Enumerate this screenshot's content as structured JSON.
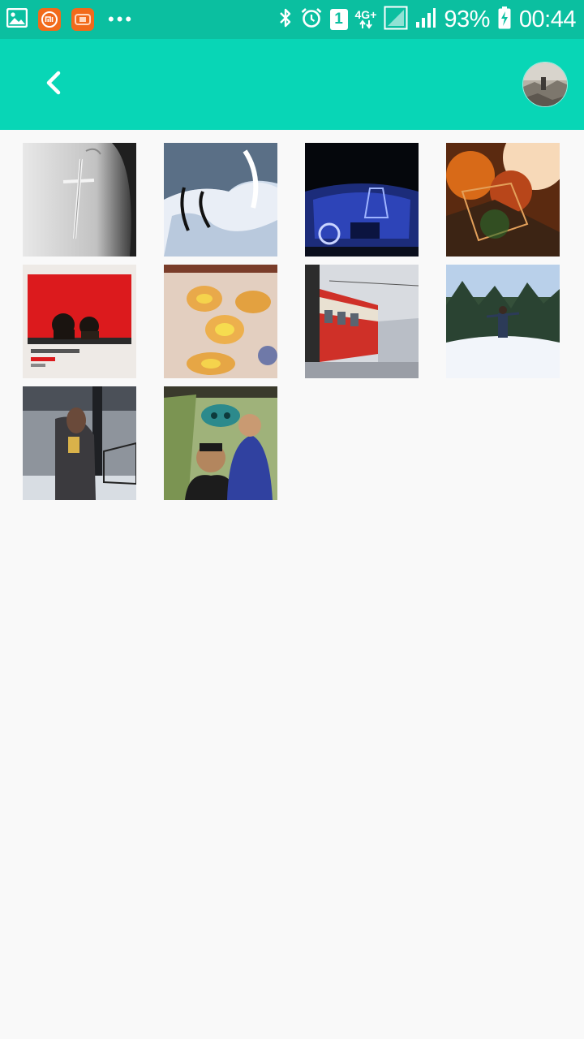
{
  "status_bar": {
    "battery": "93%",
    "time": "00:44",
    "sim_slot": "1",
    "network_type": "4G+",
    "icons": [
      "gallery-icon",
      "mi-app-icon",
      "orange-app-icon",
      "more-notifications-icon",
      "bluetooth-icon",
      "alarm-icon",
      "sim-1-icon",
      "network-4g-icon",
      "signal-icon",
      "battery-charging-icon"
    ]
  },
  "app_bar": {
    "back_icon": "chevron-left-icon",
    "colors": {
      "status_bar": "#0bbfa0",
      "app_bar": "#08d6b6",
      "background": "#f9f9f9"
    }
  },
  "photos": [
    {
      "id": "photo-earring",
      "subject": "cross earring close-up, black and white"
    },
    {
      "id": "photo-snow-ice",
      "subject": "ice and snow with black marks"
    },
    {
      "id": "photo-car-dashboard",
      "subject": "car dashboard at night, blue tint"
    },
    {
      "id": "photo-autumn-leaves",
      "subject": "sunlit autumn leaves"
    },
    {
      "id": "photo-youtube-frame",
      "subject": "two people in a YouTube frame"
    },
    {
      "id": "photo-khachapuri",
      "subject": "khachapuri on a checkered tablecloth"
    },
    {
      "id": "photo-tram",
      "subject": "red tram on a street"
    },
    {
      "id": "photo-winter-forest",
      "subject": "person in a snowy forest"
    },
    {
      "id": "photo-mirror-selfie",
      "subject": "mirror selfie in an office"
    },
    {
      "id": "photo-masquerade",
      "subject": "two people, one wearing a mask"
    }
  ]
}
